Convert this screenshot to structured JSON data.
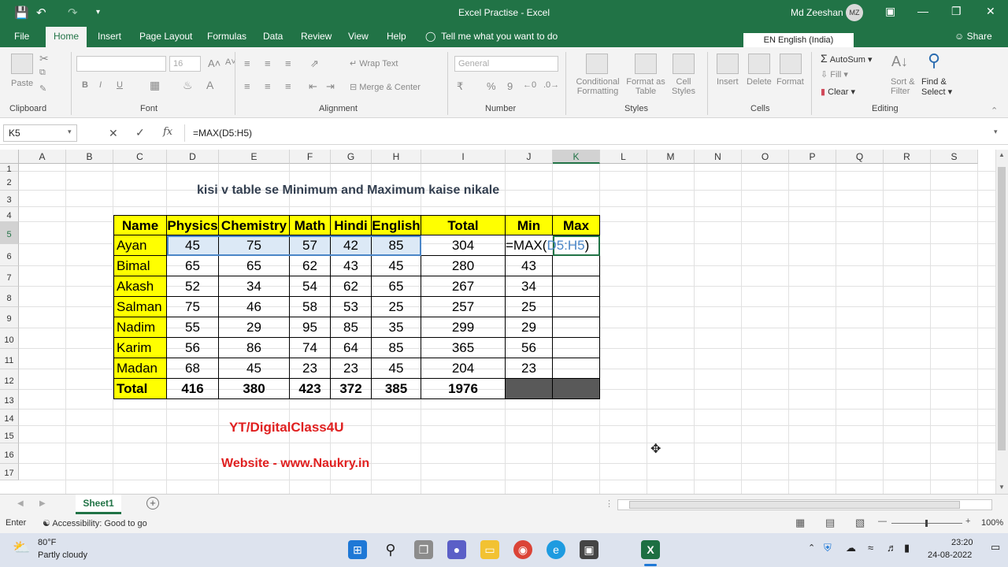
{
  "app": {
    "title": "Excel Practise  -  Excel",
    "user": "Md Zeeshan",
    "avatar": "MZ"
  },
  "menu": {
    "tabs": [
      "File",
      "Home",
      "Insert",
      "Page Layout",
      "Formulas",
      "Data",
      "Review",
      "View",
      "Help"
    ],
    "tell_me": "Tell me what you want to do",
    "language": "EN English (India)",
    "share": "Share"
  },
  "ribbon": {
    "clipboard": {
      "label": "Clipboard",
      "paste": "Paste"
    },
    "font": {
      "label": "Font",
      "name_value": "",
      "size_value": "16"
    },
    "alignment": {
      "label": "Alignment",
      "wrap_text": "Wrap Text",
      "merge_center": "Merge & Center"
    },
    "number": {
      "label": "Number",
      "format_value": "General"
    },
    "styles": {
      "label": "Styles",
      "conditional": "Conditional",
      "formatting": "Formatting",
      "format_as": "Format as",
      "table": "Table",
      "cell": "Cell",
      "styles": "Styles"
    },
    "cells": {
      "label": "Cells",
      "insert": "Insert",
      "delete": "Delete",
      "format": "Format"
    },
    "editing": {
      "label": "Editing",
      "autosum": "AutoSum",
      "fill": "Fill",
      "clear": "Clear",
      "sort": "Sort &",
      "filter": "Filter",
      "find": "Find &",
      "select": "Select"
    }
  },
  "formula_bar": {
    "name_box": "K5",
    "formula": "=MAX(D5:H5)"
  },
  "columns": [
    "A",
    "B",
    "C",
    "D",
    "E",
    "F",
    "G",
    "H",
    "I",
    "J",
    "K",
    "L",
    "M",
    "N",
    "O",
    "P",
    "Q",
    "R",
    "S"
  ],
  "rows": [
    "1",
    "2",
    "3",
    "4",
    "5",
    "6",
    "7",
    "8",
    "9",
    "10",
    "11",
    "12",
    "13",
    "14",
    "15",
    "16",
    "17"
  ],
  "sheet": {
    "caption": "kisi v table se Minimum and Maximum kaise nikale",
    "headers": [
      "Name",
      "Physics",
      "Chemistry",
      "Math",
      "Hindi",
      "English",
      "Total",
      "Min",
      "Max"
    ],
    "data": [
      [
        "Ayan",
        "45",
        "75",
        "57",
        "42",
        "85",
        "304",
        "=MAX(D5:H5)",
        ""
      ],
      [
        "Bimal",
        "65",
        "65",
        "62",
        "43",
        "45",
        "280",
        "43",
        ""
      ],
      [
        "Akash",
        "52",
        "34",
        "54",
        "62",
        "65",
        "267",
        "34",
        ""
      ],
      [
        "Salman",
        "75",
        "46",
        "58",
        "53",
        "25",
        "257",
        "25",
        ""
      ],
      [
        "Nadim",
        "55",
        "29",
        "95",
        "85",
        "35",
        "299",
        "29",
        ""
      ],
      [
        "Karim",
        "56",
        "86",
        "74",
        "64",
        "85",
        "365",
        "56",
        ""
      ],
      [
        "Madan",
        "68",
        "45",
        "23",
        "23",
        "45",
        "204",
        "23",
        ""
      ]
    ],
    "total": [
      "Total",
      "416",
      "380",
      "423",
      "372",
      "385",
      "1976",
      "",
      ""
    ],
    "yt": "YT/DigitalClass4U",
    "website": "Website - www.Naukry.in"
  },
  "sheet_tab": "Sheet1",
  "status": {
    "mode": "Enter",
    "accessibility": "Accessibility: Good to go",
    "zoom": "100%"
  },
  "taskbar": {
    "temp": "80°F",
    "weather": "Partly cloudy",
    "time": "23:20",
    "date": "24-08-2022"
  }
}
